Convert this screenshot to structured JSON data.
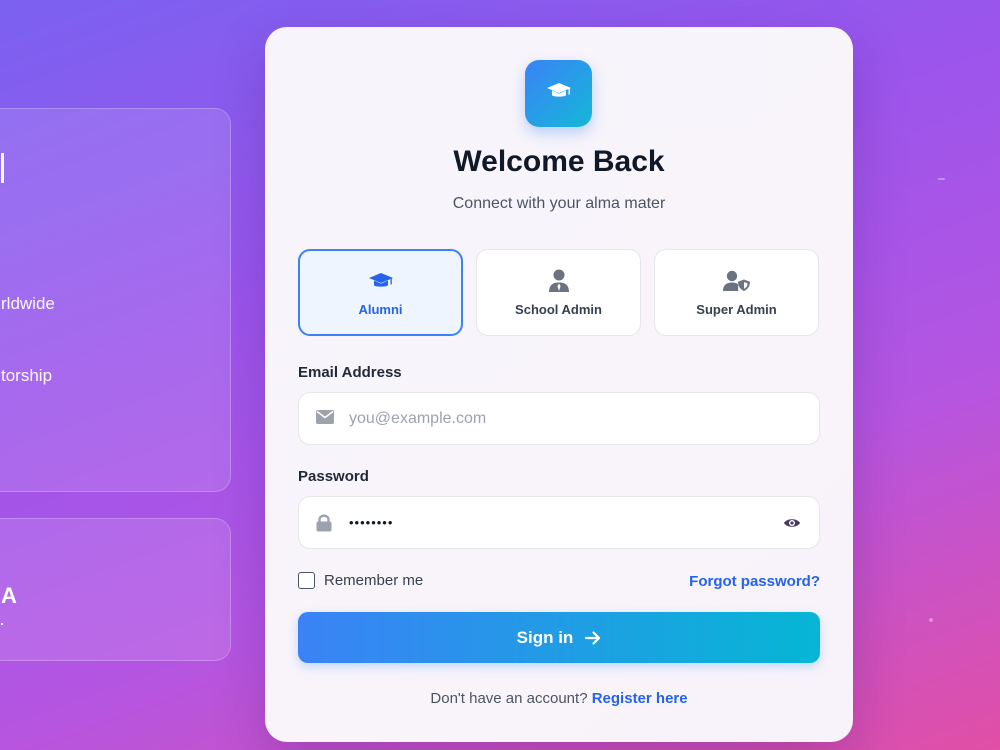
{
  "background_panel": {
    "lines": [
      "rldwide",
      "torship"
    ],
    "partial_big": "A"
  },
  "card": {
    "logo_icon": "graduation-cap-icon",
    "title": "Welcome Back",
    "subtitle": "Connect with your alma mater",
    "roles": [
      {
        "label": "Alumni",
        "icon": "graduation-cap-icon",
        "active": true
      },
      {
        "label": "School Admin",
        "icon": "user-tie-icon",
        "active": false
      },
      {
        "label": "Super Admin",
        "icon": "user-shield-icon",
        "active": false
      }
    ],
    "email": {
      "label": "Email Address",
      "placeholder": "you@example.com",
      "value": "",
      "icon": "envelope-icon"
    },
    "password": {
      "label": "Password",
      "value": "password",
      "icon": "lock-icon",
      "toggle_icon": "eye-icon"
    },
    "remember_label": "Remember me",
    "remember_checked": false,
    "forgot_label": "Forgot password?",
    "signin_label": "Sign in",
    "signin_icon": "arrow-right-icon",
    "footer_text": "Don't have an account?",
    "register_label": "Register here"
  },
  "colors": {
    "accent": "#3b82f6",
    "accent_alt": "#06b6d4",
    "link": "#2563eb",
    "heading": "#111827"
  }
}
